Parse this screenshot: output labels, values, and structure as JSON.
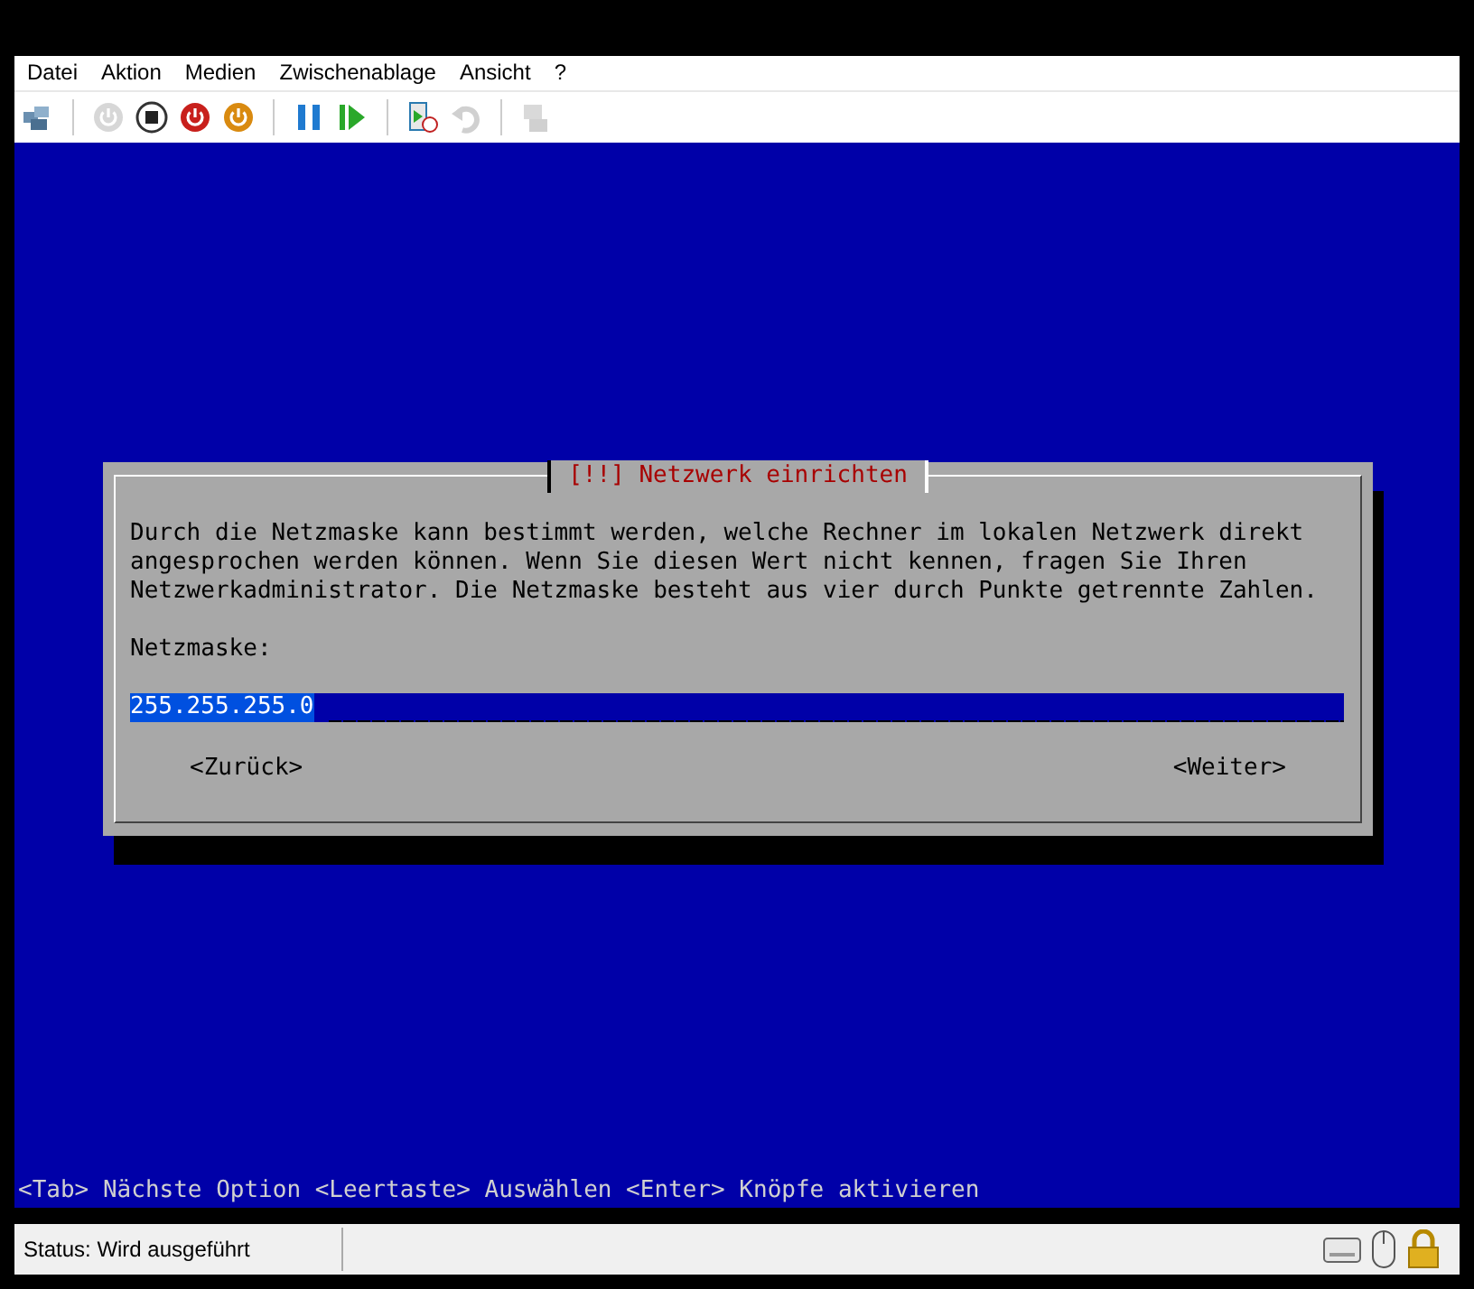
{
  "menu": [
    "Datei",
    "Aktion",
    "Medien",
    "Zwischenablage",
    "Ansicht",
    "?"
  ],
  "toolbar": [
    [
      {
        "kind": "ctrl-alt-del",
        "disabled": false
      }
    ],
    [
      {
        "kind": "power",
        "disabled": true
      },
      {
        "kind": "stop",
        "disabled": false
      },
      {
        "kind": "power-red",
        "disabled": false
      },
      {
        "kind": "power-orange",
        "disabled": false
      }
    ],
    [
      {
        "kind": "pause",
        "disabled": false
      },
      {
        "kind": "play",
        "disabled": false
      }
    ],
    [
      {
        "kind": "checkpoint",
        "disabled": false
      },
      {
        "kind": "revert",
        "disabled": true
      }
    ],
    [
      {
        "kind": "share",
        "disabled": true
      }
    ]
  ],
  "dialog": {
    "title": "[!!] Netzwerk einrichten",
    "text": [
      "Durch die Netzmaske kann bestimmt werden, welche Rechner im lokalen Netzwerk direkt",
      "angesprochen werden können. Wenn Sie diesen Wert nicht kennen, fragen Sie Ihren",
      "Netzwerkadministrator. Die Netzmaske besteht aus vier durch Punkte getrennte Zahlen."
    ],
    "field_label": "Netzmaske:",
    "field_value": "255.255.255.0",
    "buttons": [
      {
        "label": "<Zurück>",
        "selected": false
      },
      {
        "label": "<Weiter>",
        "selected": false
      }
    ]
  },
  "hint": "<Tab> Nächste Option <Leertaste> Auswählen <Enter> Knöpfe aktivieren",
  "status": "Status: Wird ausgeführt"
}
